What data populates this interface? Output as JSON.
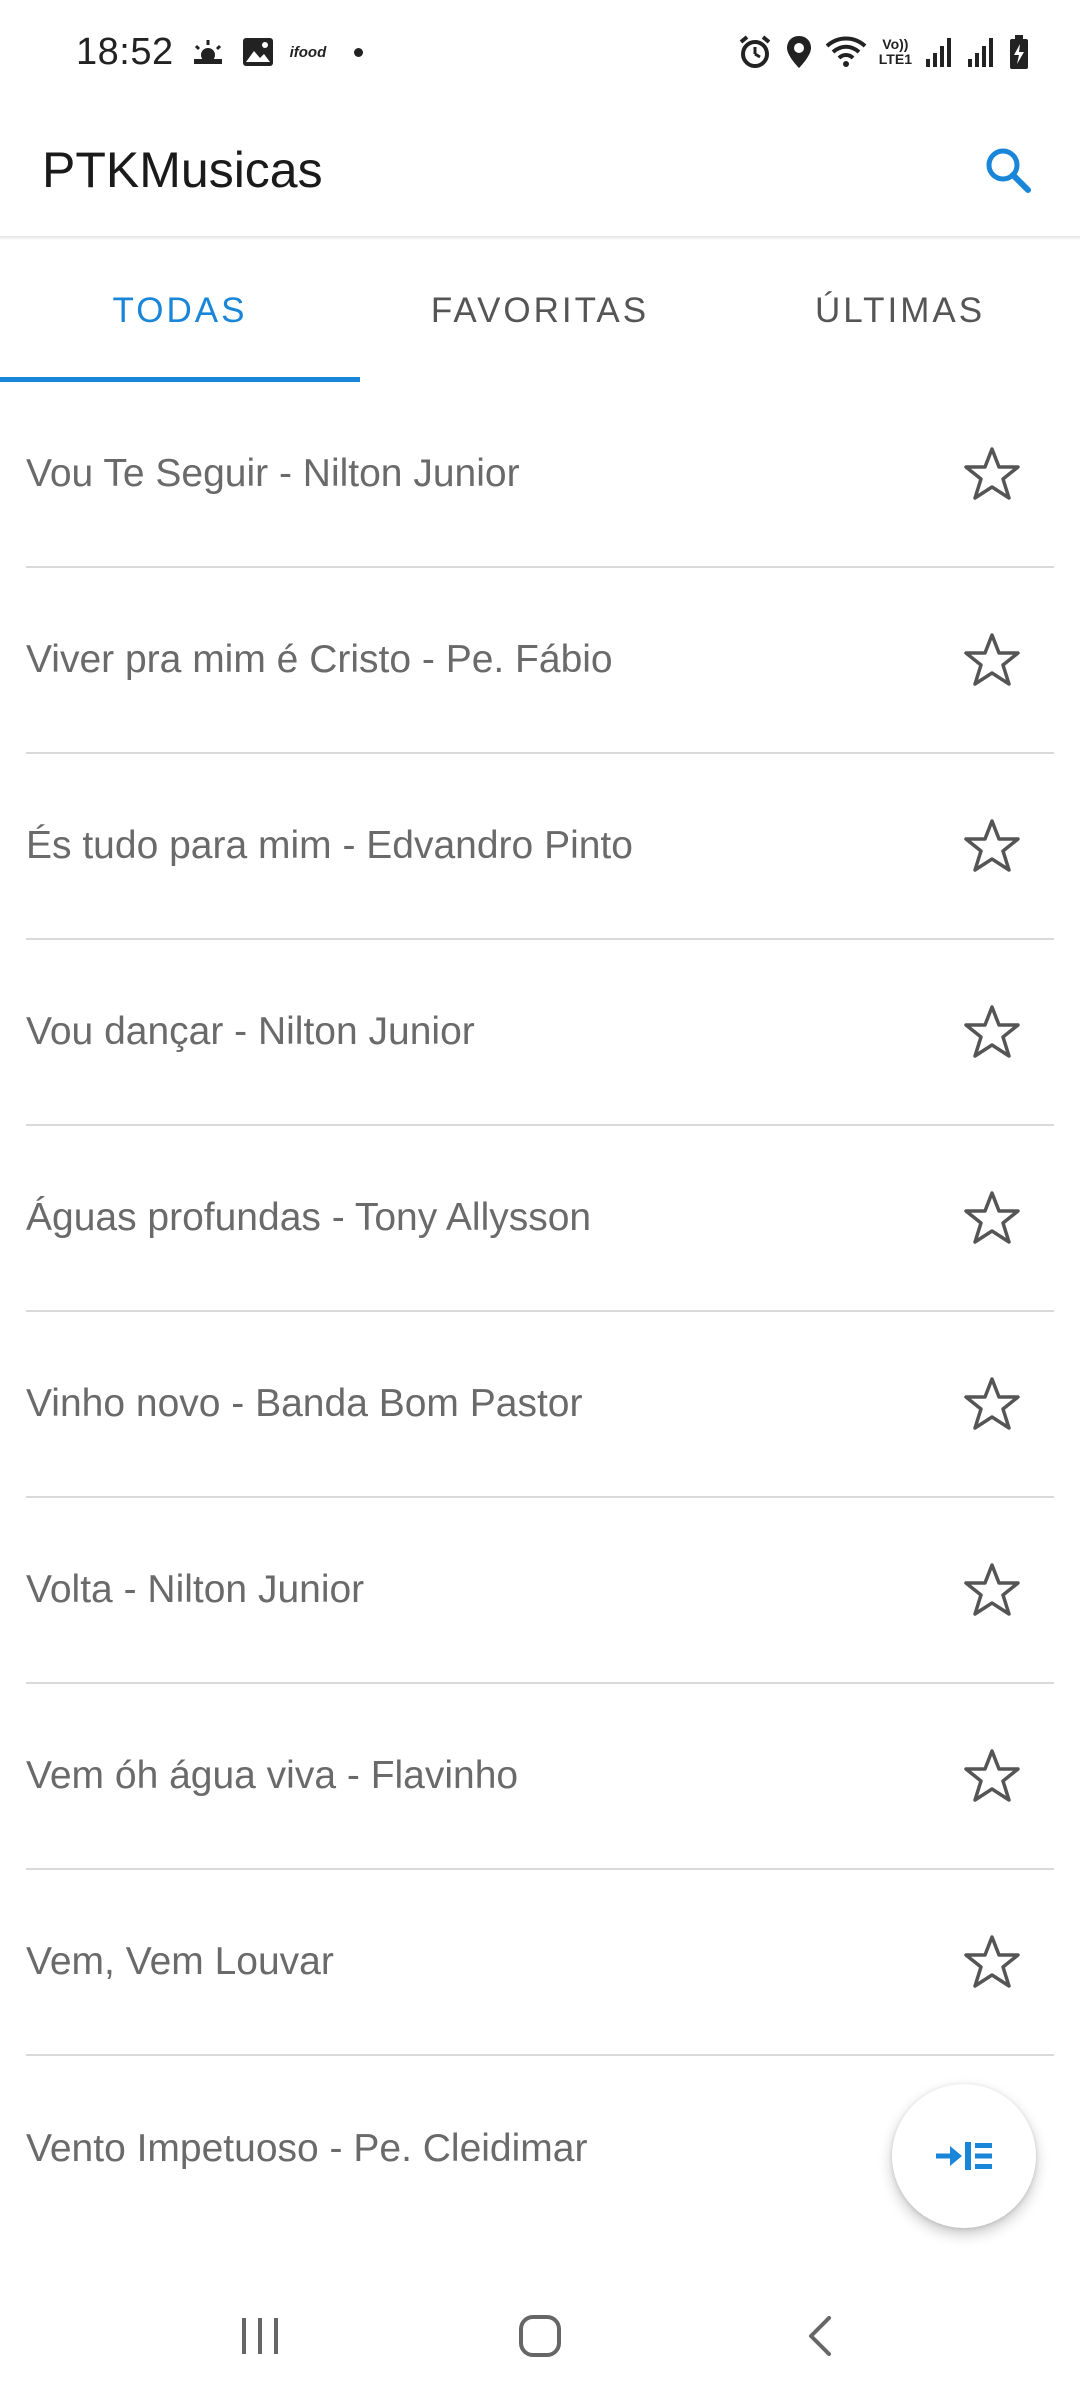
{
  "status_bar": {
    "time": "18:52",
    "notification_icons": [
      "weather-sunset-icon",
      "image-icon",
      "ifood-icon",
      "dot-icon"
    ],
    "ifood_label": "ifood",
    "volte_line1": "Vo))",
    "volte_line2": "LTE1",
    "system_icons": [
      "alarm-icon",
      "location-icon",
      "wifi-icon",
      "volte-icon",
      "signal-icon",
      "signal-icon",
      "battery-charging-icon"
    ]
  },
  "app_bar": {
    "title": "PTKMusicas",
    "search_icon": "search-icon",
    "accent_color": "#1a86d9"
  },
  "tabs": [
    {
      "label": "TODAS",
      "active": true
    },
    {
      "label": "FAVORITAS",
      "active": false
    },
    {
      "label": "ÚLTIMAS",
      "active": false
    }
  ],
  "songs": [
    {
      "title": "Vou Te Seguir - Nilton Junior",
      "favorite": false
    },
    {
      "title": "Viver pra mim é Cristo - Pe. Fábio",
      "favorite": false
    },
    {
      "title": "És tudo para mim - Edvandro Pinto",
      "favorite": false
    },
    {
      "title": "Vou dançar - Nilton Junior",
      "favorite": false
    },
    {
      "title": "Águas profundas - Tony Allysson",
      "favorite": false
    },
    {
      "title": "Vinho novo - Banda Bom Pastor",
      "favorite": false
    },
    {
      "title": "Volta - Nilton Junior",
      "favorite": false
    },
    {
      "title": "Vem óh água viva - Flavinho",
      "favorite": false
    },
    {
      "title": "Vem, Vem Louvar",
      "favorite": false
    },
    {
      "title": "Vento Impetuoso - Pe. Cleidimar",
      "favorite": false
    }
  ],
  "fab": {
    "icon": "indent-list-icon"
  },
  "nav_bar": {
    "icons": [
      "recent-apps-icon",
      "home-icon",
      "back-icon"
    ]
  }
}
